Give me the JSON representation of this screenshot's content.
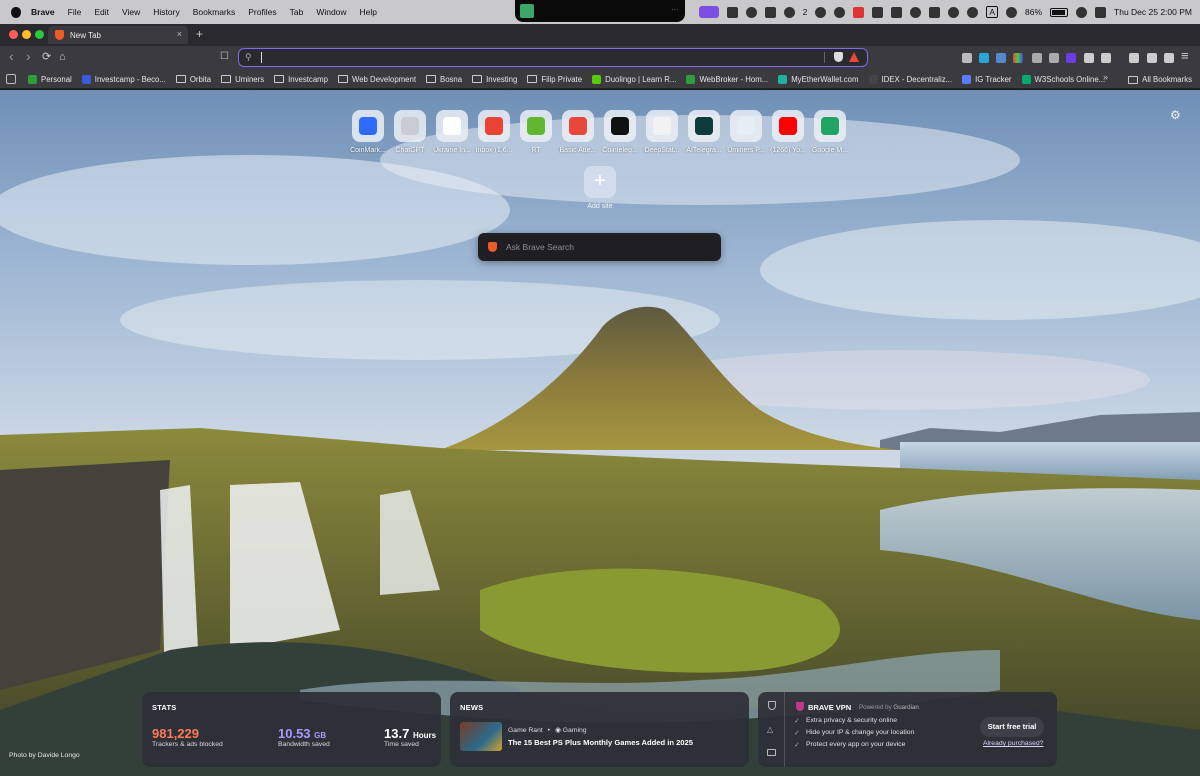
{
  "menubar": {
    "app": "Brave",
    "items": [
      "File",
      "Edit",
      "View",
      "History",
      "Bookmarks",
      "Profiles",
      "Tab",
      "Window",
      "Help"
    ],
    "wechat_count": "2",
    "input_source": "A",
    "battery": "86%",
    "clock": "Thu Dec 25  2:00 PM"
  },
  "tab": {
    "title": "New Tab",
    "close": "×",
    "new": "+"
  },
  "toolbar": {
    "back": "‹",
    "forward": "›",
    "reload": "⟳",
    "home": "⌂",
    "bookmark": "☐",
    "url_value": "",
    "menu": "≡"
  },
  "bookmarks": [
    {
      "label": "Personal",
      "type": "site",
      "color": "#2e9d3b"
    },
    {
      "label": "Investcamp - Beco...",
      "type": "site",
      "color": "#3b5bdb"
    },
    {
      "label": "Orbita",
      "type": "folder"
    },
    {
      "label": "Uminers",
      "type": "folder"
    },
    {
      "label": "Investcamp",
      "type": "folder"
    },
    {
      "label": "Web Development",
      "type": "folder"
    },
    {
      "label": "Bosna",
      "type": "folder"
    },
    {
      "label": "Investing",
      "type": "folder"
    },
    {
      "label": "Filip Private",
      "type": "folder"
    },
    {
      "label": "Duolingo | Learn R...",
      "type": "site",
      "color": "#58cc02"
    },
    {
      "label": "WebBroker - Hom...",
      "type": "site",
      "color": "#2e9d3b"
    },
    {
      "label": "MyEtherWallet.com",
      "type": "site",
      "color": "#1eb19d"
    },
    {
      "label": "IDEX - Decentraliz...",
      "type": "site",
      "color": "#444"
    },
    {
      "label": "IG Tracker",
      "type": "site",
      "color": "#5b7cfa"
    },
    {
      "label": "W3Schools Online...",
      "type": "site",
      "color": "#04aa6d"
    }
  ],
  "bookmarks_more": "»",
  "all_bookmarks": "All Bookmarks",
  "top_sites": [
    {
      "label": "CoinMark...",
      "color": "#2f6bff"
    },
    {
      "label": "ChatGPT",
      "color": "#c9ccd2"
    },
    {
      "label": "Ukraine In...",
      "color": "#ffffff"
    },
    {
      "label": "Inbox (1,6...",
      "color": "#ea4335"
    },
    {
      "label": "RT",
      "color": "#5fb830"
    },
    {
      "label": "Basic Atte...",
      "color": "#e8473a"
    },
    {
      "label": "Cointeleg...",
      "color": "#111111"
    },
    {
      "label": "DeepStat...",
      "color": "#f2f2f2"
    },
    {
      "label": "AITelegra...",
      "color": "#0d3b3b"
    },
    {
      "label": "Uminers P...",
      "color": "#e6edf5"
    },
    {
      "label": "(1266) Yo...",
      "color": "#ff0000"
    },
    {
      "label": "Google M...",
      "color": "#1fa463"
    }
  ],
  "add_site": {
    "plus": "+",
    "label": "Add site"
  },
  "search": {
    "placeholder": "Ask Brave Search"
  },
  "stats": {
    "title": "STATS",
    "trackers_value": "981,229",
    "trackers_label": "Trackers & ads blocked",
    "bandwidth_value": "10.53",
    "bandwidth_unit": "GB",
    "bandwidth_label": "Bandwidth saved",
    "time_value": "13.7",
    "time_unit": "Hours",
    "time_label": "Time saved",
    "colors": {
      "trackers": "#ff7a59",
      "bandwidth": "#a99bff",
      "time": "#ffffff"
    }
  },
  "news": {
    "title": "NEWS",
    "source": "Game Rant",
    "sep": "•",
    "category": "Gaming",
    "headline": "The 15 Best PS Plus Monthly Games Added in 2025"
  },
  "vpn": {
    "title": "BRAVE VPN",
    "powered": "Powered by",
    "partner": "Guardian",
    "features": [
      "Extra privacy & security online",
      "Hide your IP & change your location",
      "Protect every app on your device"
    ],
    "cta": "Start free trial",
    "link": "Already purchased?"
  },
  "photo_credit": "Photo by Davide Longo"
}
